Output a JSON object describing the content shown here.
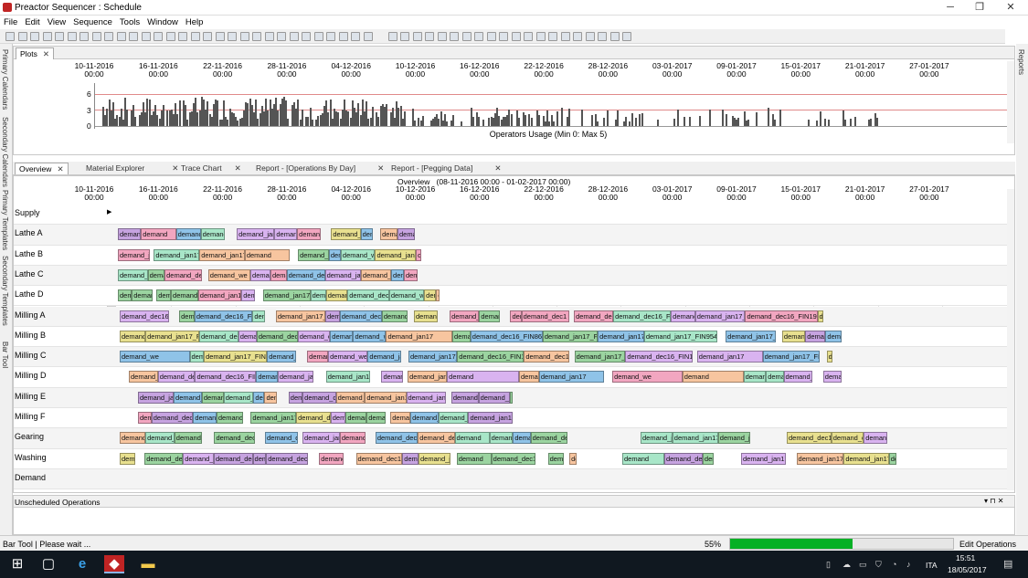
{
  "window": {
    "title": "Preactor Sequencer : Schedule",
    "minimize": "─",
    "maximize": "❐",
    "close": "✕"
  },
  "menu": [
    "File",
    "Edit",
    "View",
    "Sequence",
    "Tools",
    "Window",
    "Help"
  ],
  "left_vertical_tabs": [
    "Primary Calendars",
    "Secondary Calendars",
    "Primary Templates",
    "Secondary Templates",
    "Bar Tool"
  ],
  "right_vertical_tabs": [
    "Reports"
  ],
  "plots_panel": {
    "tab_label": "Plots",
    "close": "✕",
    "dates": [
      {
        "d": "10-11-2016",
        "t": "00:00"
      },
      {
        "d": "16-11-2016",
        "t": "00:00"
      },
      {
        "d": "22-11-2016",
        "t": "00:00"
      },
      {
        "d": "28-11-2016",
        "t": "00:00"
      },
      {
        "d": "04-12-2016",
        "t": "00:00"
      },
      {
        "d": "10-12-2016",
        "t": "00:00"
      },
      {
        "d": "16-12-2016",
        "t": "00:00"
      },
      {
        "d": "22-12-2016",
        "t": "00:00"
      },
      {
        "d": "28-12-2016",
        "t": "00:00"
      },
      {
        "d": "03-01-2017",
        "t": "00:00"
      },
      {
        "d": "09-01-2017",
        "t": "00:00"
      },
      {
        "d": "15-01-2017",
        "t": "00:00"
      },
      {
        "d": "21-01-2017",
        "t": "00:00"
      },
      {
        "d": "27-01-2017",
        "t": "00:00"
      }
    ],
    "y_ticks": [
      "6",
      "3",
      "0"
    ],
    "caption": "Operators Usage (Min 0: Max 5)"
  },
  "tabs": [
    {
      "label": "Overview",
      "active": true
    },
    {
      "label": "Material Explorer"
    },
    {
      "label": "Trace Chart"
    },
    {
      "label": "Report - [Operations By Day]"
    },
    {
      "label": "Report - [Pegging Data]"
    }
  ],
  "overview": {
    "header": "Overview   (08-11-2016 00:00 - 01-02-2017 00:00)",
    "rows": [
      "Supply",
      "Lathe A",
      "Lathe B",
      "Lathe C",
      "Lathe D",
      "Milling A",
      "Milling B",
      "Milling C",
      "Milling D",
      "Milling E",
      "Milling F",
      "Gearing",
      "Washing",
      "Demand"
    ],
    "bar_texts": [
      "demand_dec16_FIN853_1",
      "demand_jan17_FIN190_1",
      "demand_jan17_FIN871_1",
      "demand_dec16_FIN868_1",
      "demand_jan17_FIN833_1",
      "demand_dec16_FIN180_1",
      "demand_jan17_FIN954_1",
      "demand_dec16_FIN871_1",
      "demand_dec16_FIN190_1",
      "demand_jan17_FIN180_1",
      "demand_jan17_FIN954_1",
      "demand_dec16_FIN868_1",
      "demand_jan17",
      "demand_dec1",
      "demand_we",
      "demand"
    ]
  },
  "unscheduled": {
    "title": "Unscheduled Operations"
  },
  "status": {
    "left": "Bar Tool | Please wait ...",
    "percent": "55%",
    "progress": 0.55,
    "mode": "Edit Operations"
  },
  "taskbar": {
    "time": "15:51",
    "date": "18/05/2017",
    "lang": "ITA"
  },
  "colors": {
    "accent": "#00b33c",
    "bar_palette": [
      "#9bd4a0",
      "#c6a3e0",
      "#f2a6c0",
      "#8fc3e8",
      "#e8e08f",
      "#a8e6c8",
      "#d9b3f0",
      "#f7c59f"
    ]
  }
}
